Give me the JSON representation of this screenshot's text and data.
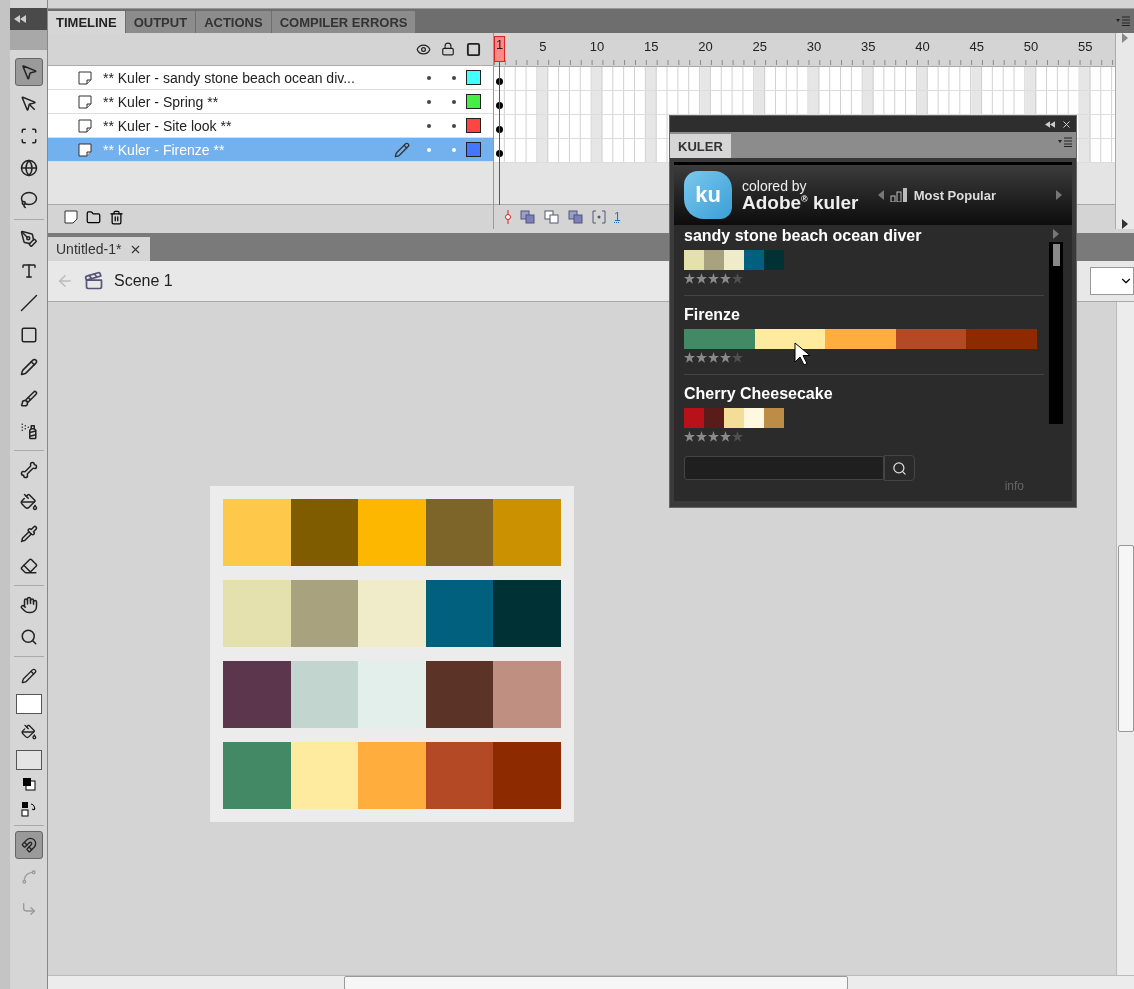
{
  "tools": [
    {
      "selected": true
    },
    {
      "selected": false
    },
    {
      "selected": false
    },
    {
      "selected": false
    },
    {
      "selected": false
    },
    {
      "selected": false
    },
    {
      "selected": false
    },
    {
      "selected": false
    },
    {
      "selected": false
    },
    {
      "selected": false
    },
    {
      "selected": false
    },
    {
      "selected": false
    },
    {
      "selected": false
    },
    {
      "selected": false
    },
    {
      "selected": false
    },
    {
      "selected": false
    },
    {
      "selected": false
    },
    {
      "selected": false
    }
  ],
  "tool_options": [
    {
      "on": true,
      "disabled": false
    },
    {
      "on": false,
      "disabled": true
    },
    {
      "on": false,
      "disabled": true
    }
  ],
  "panel_tabs": [
    {
      "label": "TIMELINE",
      "selected": true
    },
    {
      "label": "OUTPUT",
      "selected": false
    },
    {
      "label": "ACTIONS",
      "selected": false
    },
    {
      "label": "COMPILER ERRORS",
      "selected": false
    }
  ],
  "timeline": {
    "playhead": "1",
    "frame_numbers": [
      "5",
      "10",
      "15",
      "20",
      "25",
      "30",
      "35",
      "40",
      "45",
      "50",
      "55"
    ],
    "layers": [
      {
        "name": "** Kuler - sandy stone beach ocean div...",
        "color": "#44ffff",
        "selected": false
      },
      {
        "name": "** Kuler - Spring **",
        "color": "#44ee44",
        "selected": false
      },
      {
        "name": "** Kuler - Site look **",
        "color": "#ff4444",
        "selected": false
      },
      {
        "name": "** Kuler - Firenze **",
        "color": "#4477ff",
        "selected": true
      }
    ],
    "current_frame": "1"
  },
  "document_tabs": [
    {
      "label": "Untitled-1*",
      "selected": true
    }
  ],
  "scene": "Scene 1",
  "stage": {
    "palettes": [
      {
        "swatches": [
          {
            "color": "#fec94a"
          },
          {
            "color": "#7f5c00"
          },
          {
            "color": "#fdb700"
          },
          {
            "color": "#7d6428"
          },
          {
            "color": "#cc9100"
          }
        ]
      },
      {
        "swatches": [
          {
            "color": "#e5e1ae"
          },
          {
            "color": "#a8a37e"
          },
          {
            "color": "#f0ebc8"
          },
          {
            "color": "#00607e"
          },
          {
            "color": "#003134"
          }
        ]
      },
      {
        "swatches": [
          {
            "color": "#5b364c"
          },
          {
            "color": "#c2d6cf"
          },
          {
            "color": "#e3efea"
          },
          {
            "color": "#5b3327"
          },
          {
            "color": "#bf9082"
          }
        ]
      },
      {
        "swatches": [
          {
            "color": "#448966"
          },
          {
            "color": "#ffeb9f"
          },
          {
            "color": "#ffad3c"
          },
          {
            "color": "#b44a25"
          },
          {
            "color": "#8d2a00"
          }
        ]
      }
    ]
  },
  "kuler": {
    "tab": "KULER",
    "logo": "ku",
    "tagline": "colored by",
    "brand": "Adobe$^{®}$ kuler",
    "filter": "Most Popular",
    "themes": [
      {
        "name": "sandy stone beach ocean diver",
        "expanded": false,
        "stars": 4,
        "swatches": [
          {
            "color": "#e5e1ae"
          },
          {
            "color": "#a8a37e"
          },
          {
            "color": "#f0ebc8"
          },
          {
            "color": "#00607e"
          },
          {
            "color": "#003134"
          }
        ]
      },
      {
        "name": "Firenze",
        "expanded": true,
        "stars": 4,
        "swatches": [
          {
            "color": "#448966"
          },
          {
            "color": "#ffeb9f"
          },
          {
            "color": "#ffad3c"
          },
          {
            "color": "#b44a25"
          },
          {
            "color": "#8d2a00"
          }
        ]
      },
      {
        "name": "Cherry Cheesecake",
        "expanded": false,
        "stars": 4,
        "swatches": [
          {
            "color": "#b8111a"
          },
          {
            "color": "#5a1b1b"
          },
          {
            "color": "#f4dd96"
          },
          {
            "color": "#fdf8de"
          },
          {
            "color": "#bd8d48"
          }
        ]
      }
    ],
    "info_link": "info"
  }
}
